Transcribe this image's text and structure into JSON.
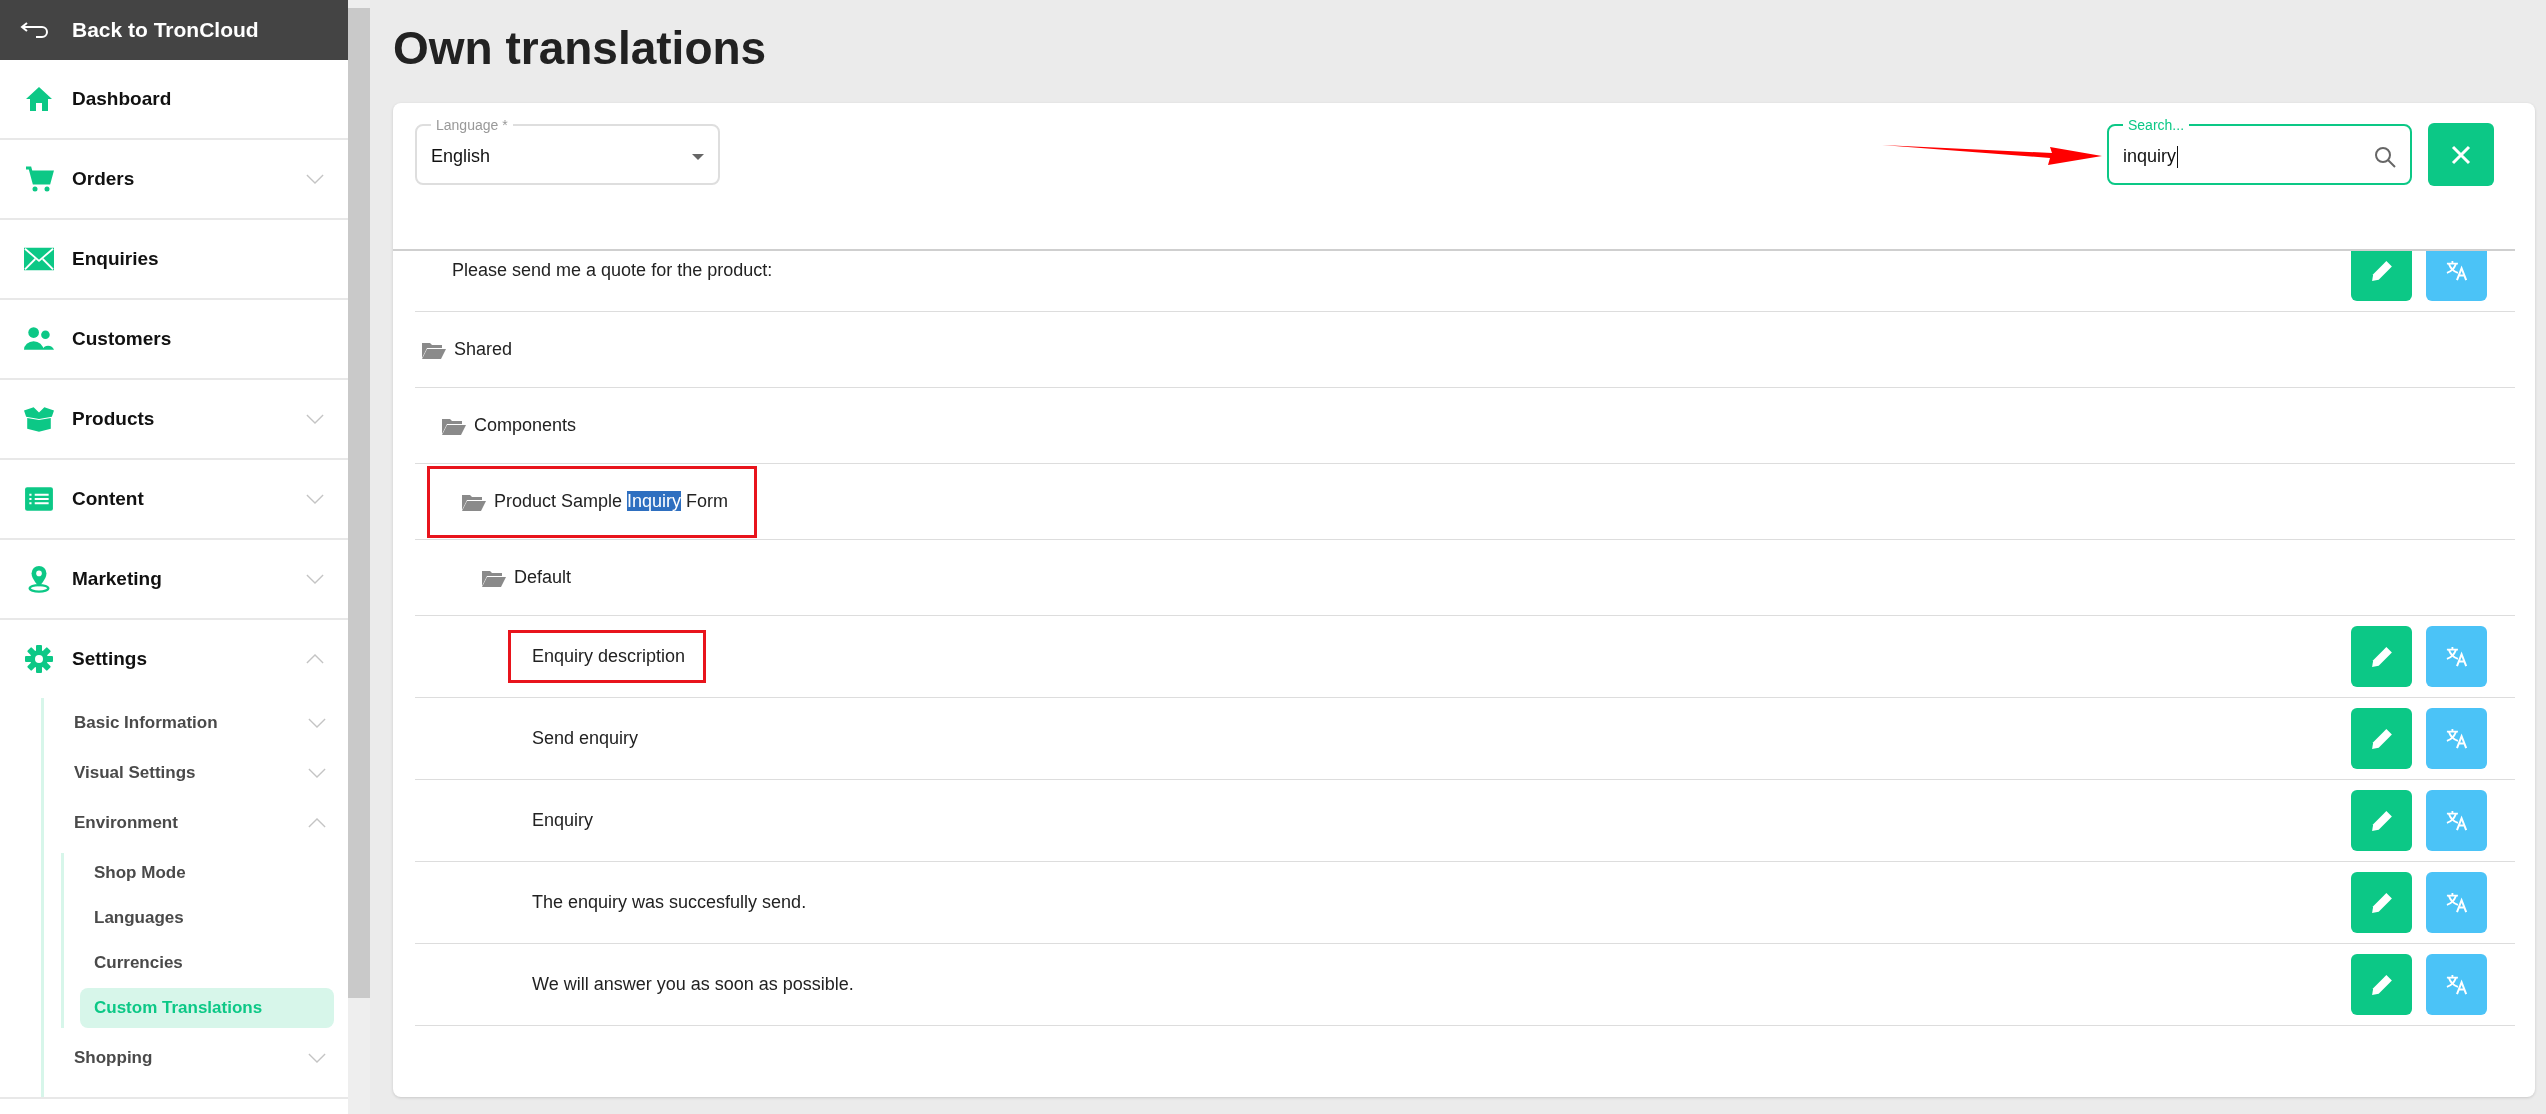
{
  "sidebar": {
    "back_label": "Back to TronCloud",
    "items": [
      {
        "label": "Dashboard",
        "kind": "link"
      },
      {
        "label": "Orders",
        "kind": "group",
        "expanded": false
      },
      {
        "label": "Enquiries",
        "kind": "link"
      },
      {
        "label": "Customers",
        "kind": "link"
      },
      {
        "label": "Products",
        "kind": "group",
        "expanded": false
      },
      {
        "label": "Content",
        "kind": "group",
        "expanded": false
      },
      {
        "label": "Marketing",
        "kind": "group",
        "expanded": false
      },
      {
        "label": "Settings",
        "kind": "group",
        "expanded": true,
        "children": [
          {
            "label": "Basic Information",
            "kind": "group",
            "expanded": false
          },
          {
            "label": "Visual Settings",
            "kind": "group",
            "expanded": false
          },
          {
            "label": "Environment",
            "kind": "group",
            "expanded": true,
            "children": [
              {
                "label": "Shop Mode",
                "selected": false
              },
              {
                "label": "Languages",
                "selected": false
              },
              {
                "label": "Currencies",
                "selected": false
              },
              {
                "label": "Custom Translations",
                "selected": true
              }
            ]
          },
          {
            "label": "Shopping",
            "kind": "group",
            "expanded": false
          }
        ]
      }
    ]
  },
  "page_title": "Own translations",
  "language": {
    "label": "Language *",
    "value": "English"
  },
  "search": {
    "label": "Search...",
    "value": "inquiry"
  },
  "tree": {
    "rows": [
      {
        "kind": "leaf",
        "label": "Please send me a quote for the product:",
        "annotated": false
      },
      {
        "kind": "folder",
        "label": "Shared",
        "annotated": false,
        "children": [
          {
            "kind": "folder",
            "label": "Components",
            "annotated": false,
            "children": [
              {
                "kind": "folder",
                "annotated": true,
                "label_parts": [
                  {
                    "text": "Product Sample ",
                    "selected": false
                  },
                  {
                    "text": "Inquiry",
                    "selected": true
                  },
                  {
                    "text": " Form",
                    "selected": false
                  }
                ],
                "children": [
                  {
                    "kind": "folder",
                    "label": "Default",
                    "annotated": false,
                    "children": [
                      {
                        "kind": "leaf",
                        "label": "Enquiry description",
                        "annotated": true
                      },
                      {
                        "kind": "leaf",
                        "label": "Send enquiry",
                        "annotated": false
                      },
                      {
                        "kind": "leaf",
                        "label": "Enquiry",
                        "annotated": false
                      },
                      {
                        "kind": "leaf",
                        "label": "The enquiry was succesfully send.",
                        "annotated": false
                      },
                      {
                        "kind": "leaf",
                        "label": "We will answer you as soon as possible.",
                        "annotated": false
                      }
                    ]
                  }
                ]
              }
            ]
          }
        ]
      }
    ]
  }
}
